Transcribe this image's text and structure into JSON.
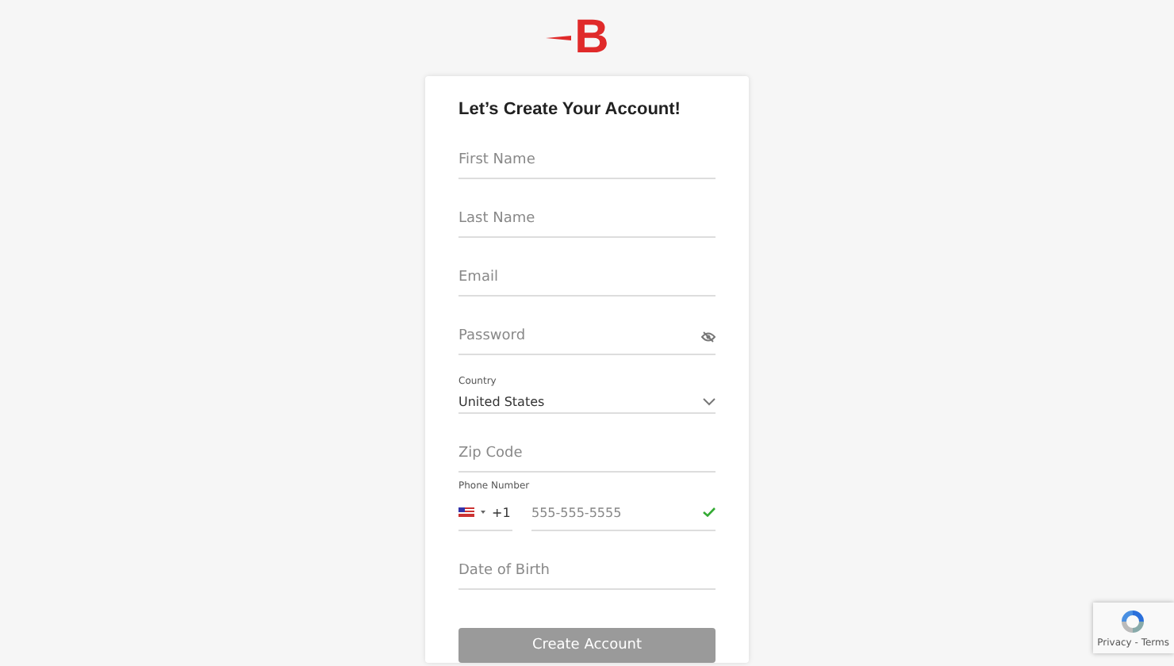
{
  "logo": "B",
  "title": "Let’s Create Your Account!",
  "fields": [
    {
      "kind": "text",
      "placeholder": "First Name"
    },
    {
      "kind": "text",
      "placeholder": "Last Name"
    },
    {
      "kind": "text",
      "placeholder": "Email"
    },
    {
      "kind": "password",
      "placeholder": "Password"
    },
    {
      "kind": "select",
      "label": "Country",
      "value": "United States"
    },
    {
      "kind": "text",
      "placeholder": "Zip Code"
    },
    {
      "kind": "phone",
      "label": "Phone Number",
      "code": "+1",
      "placeholder": "555-555-5555",
      "valid": true
    },
    {
      "kind": "text",
      "placeholder": "Date of Birth"
    }
  ],
  "submit": {
    "label": "Create Account",
    "disabled": true
  },
  "recaptcha": {
    "links": "Privacy - Terms"
  }
}
